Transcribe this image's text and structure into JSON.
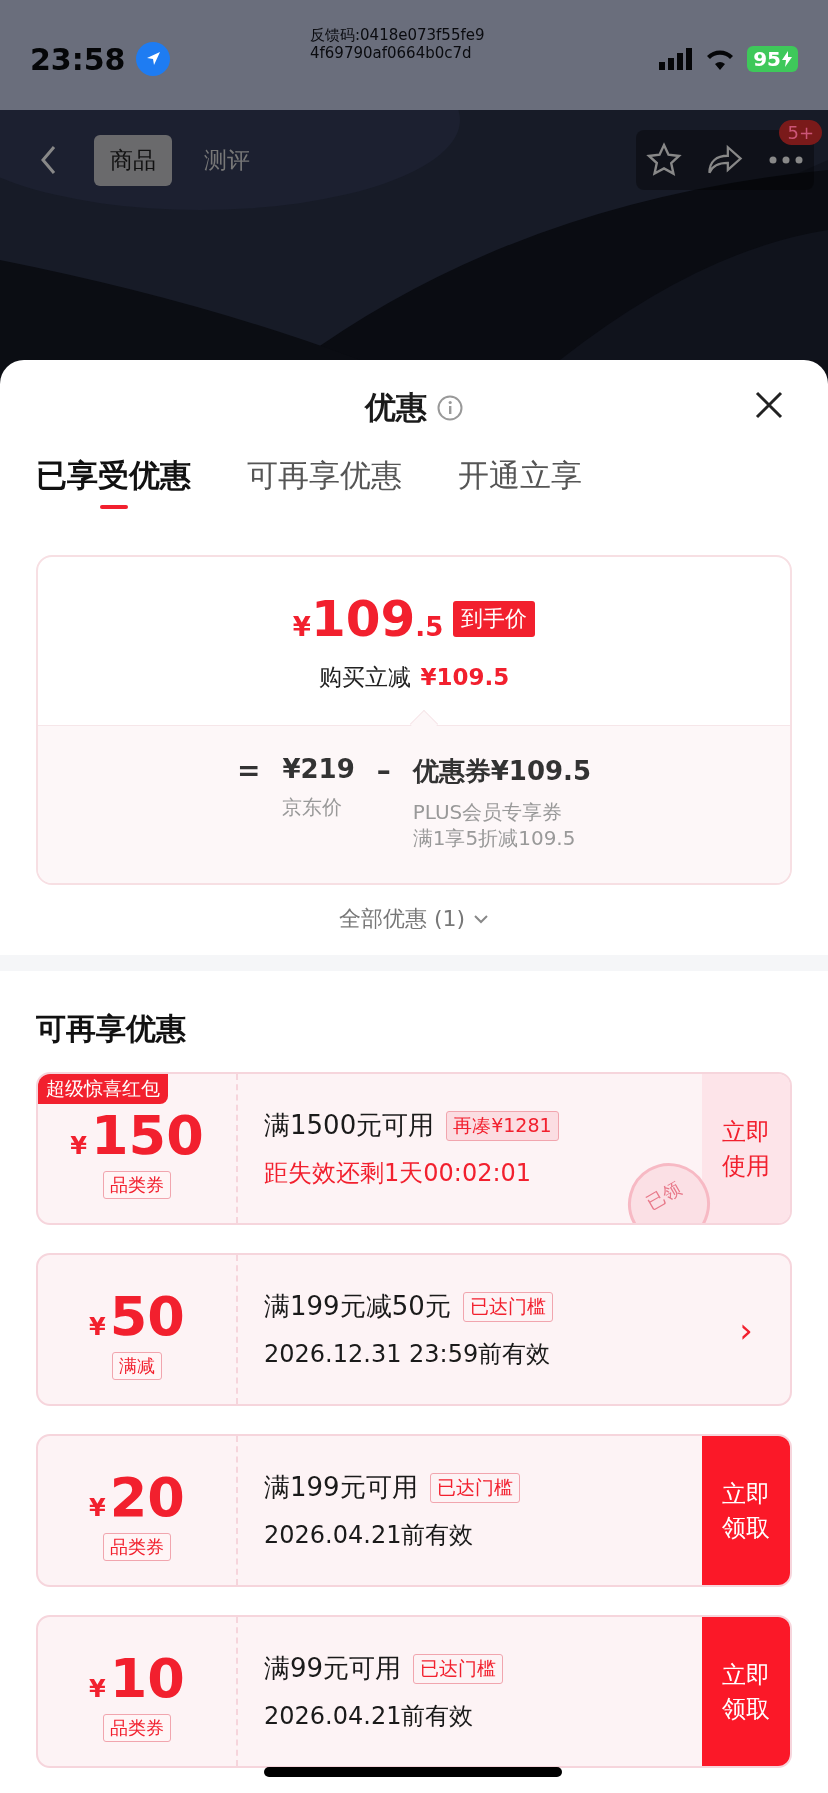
{
  "status_bar": {
    "time": "23:58",
    "feedback_code": [
      "反馈码:0418e073f55fe9",
      "4f69790af0664b0c7d"
    ],
    "battery": "95"
  },
  "nav": {
    "tabs": [
      {
        "label": "商品",
        "selected": true
      },
      {
        "label": "测评",
        "selected": false
      }
    ],
    "badge": "5+"
  },
  "sheet": {
    "title": "优惠",
    "tabs": [
      {
        "label": "已享受优惠",
        "selected": true
      },
      {
        "label": "可再享优惠",
        "selected": false
      },
      {
        "label": "开通立享",
        "selected": false
      }
    ]
  },
  "summary": {
    "currency": "¥",
    "price_int": "109",
    "price_dec": ".5",
    "price_tag": "到手价",
    "saving_label": "购买立减",
    "saving_amount": "¥109.5",
    "equals": "=",
    "base_price": "¥219",
    "base_label": "京东价",
    "minus": "–",
    "discount": "优惠券¥109.5",
    "discount_notes": [
      "PLUS会员专享券",
      "满1享5折减109.5"
    ]
  },
  "all_offers": "全部优惠 (1)",
  "section_title": "可再享优惠",
  "coupons": [
    {
      "kind": "use",
      "ribbon": "超级惊喜红包",
      "currency": "¥",
      "amount": "150",
      "type": "品类券",
      "condition": "满1500元可用",
      "tag": "再凑¥1281",
      "note": "距失效还剩1天00:02:01",
      "note_urgent": true,
      "stamp": "已领",
      "action": "立即使用"
    },
    {
      "kind": "arrow",
      "currency": "¥",
      "amount": "50",
      "type": "满减",
      "condition": "满199元减50元",
      "tag": "已达门槛",
      "note": "2026.12.31 23:59前有效",
      "note_urgent": false,
      "action": "›"
    },
    {
      "kind": "claim",
      "currency": "¥",
      "amount": "20",
      "type": "品类券",
      "condition": "满199元可用",
      "tag": "已达门槛",
      "note": "2026.04.21前有效",
      "note_urgent": false,
      "action": "立即领取"
    },
    {
      "kind": "claim",
      "currency": "¥",
      "amount": "10",
      "type": "品类券",
      "condition": "满99元可用",
      "tag": "已达门槛",
      "note": "2026.04.21前有效",
      "note_urgent": false,
      "action": "立即领取"
    }
  ]
}
